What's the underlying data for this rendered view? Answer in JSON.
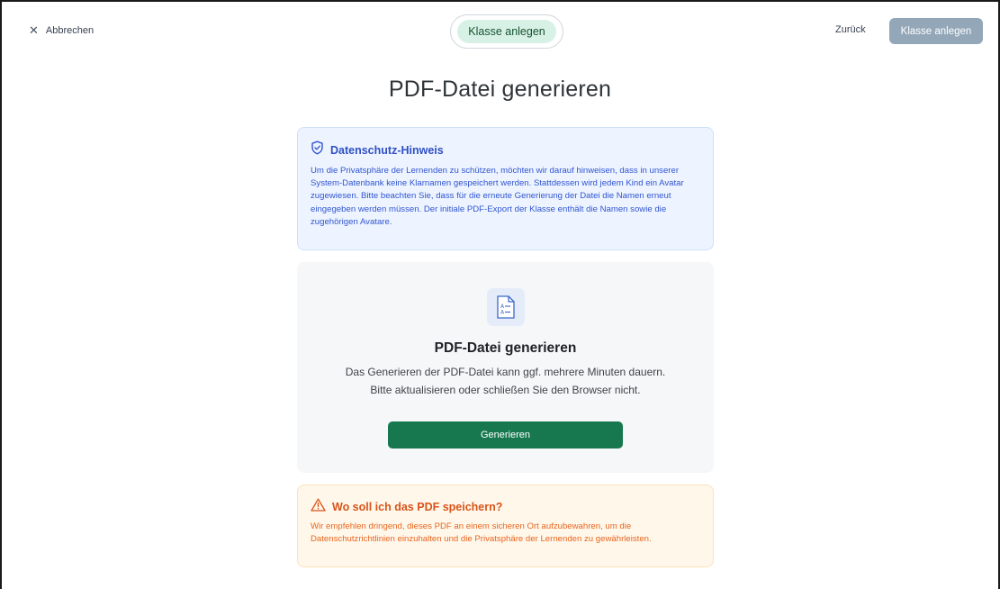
{
  "header": {
    "cancel_label": "Abbrechen",
    "step_label": "Klasse anlegen",
    "back_label": "Zurück",
    "primary_label": "Klasse anlegen"
  },
  "page": {
    "title": "PDF-Datei generieren"
  },
  "privacy_notice": {
    "title": "Datenschutz-Hinweis",
    "text": "Um die Privatsphäre der Lernenden zu schützen, möchten wir darauf hinweisen, dass in unserer System-Datenbank keine Klarnamen gespeichert werden. Stattdessen wird jedem Kind ein Avatar zugewiesen. Bitte beachten Sie, dass für die erneute Generierung der Datei die Namen erneut eingegeben werden müssen. Der initiale PDF-Export der Klasse enthält die Namen sowie die zugehörigen Avatare."
  },
  "generate_card": {
    "title": "PDF-Datei generieren",
    "desc_line1": "Das Generieren der PDF-Datei kann ggf. mehrere Minuten dauern.",
    "desc_line2": "Bitte aktualisieren oder schließen Sie den Browser nicht.",
    "button_label": "Generieren",
    "icon": "document-icon"
  },
  "warning": {
    "title": "Wo soll ich das PDF speichern?",
    "text": "Wir empfehlen dringend, dieses PDF an einem sicheren Ort aufzubewahren, um die Datenschutzrichtlinien einzuhalten und die Privatsphäre der Lernenden zu gewährleisten."
  },
  "colors": {
    "accent_green": "#17784f",
    "step_pill_bg": "#d8f1e6",
    "notice_blue": "#3155d1",
    "warning_orange": "#e8661f",
    "disabled_button": "#93a7b9"
  }
}
